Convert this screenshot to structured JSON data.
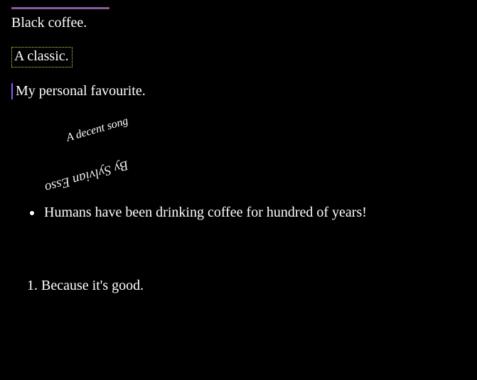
{
  "styles": {
    "rule_color": "#8a5a9c",
    "dotted_border_color": "#d8d84a",
    "left_bar_color": "#8a5aff"
  },
  "lines": {
    "line1": "Black coffee.",
    "line2": "A classic.",
    "line3": "My personal favourite."
  },
  "rotated": {
    "a": "A decent song",
    "b": "By Sylvian Esso"
  },
  "bullet_items": [
    "Humans have been drinking coffee for hundred of years!"
  ],
  "ordered_items": [
    "Because it's good."
  ]
}
